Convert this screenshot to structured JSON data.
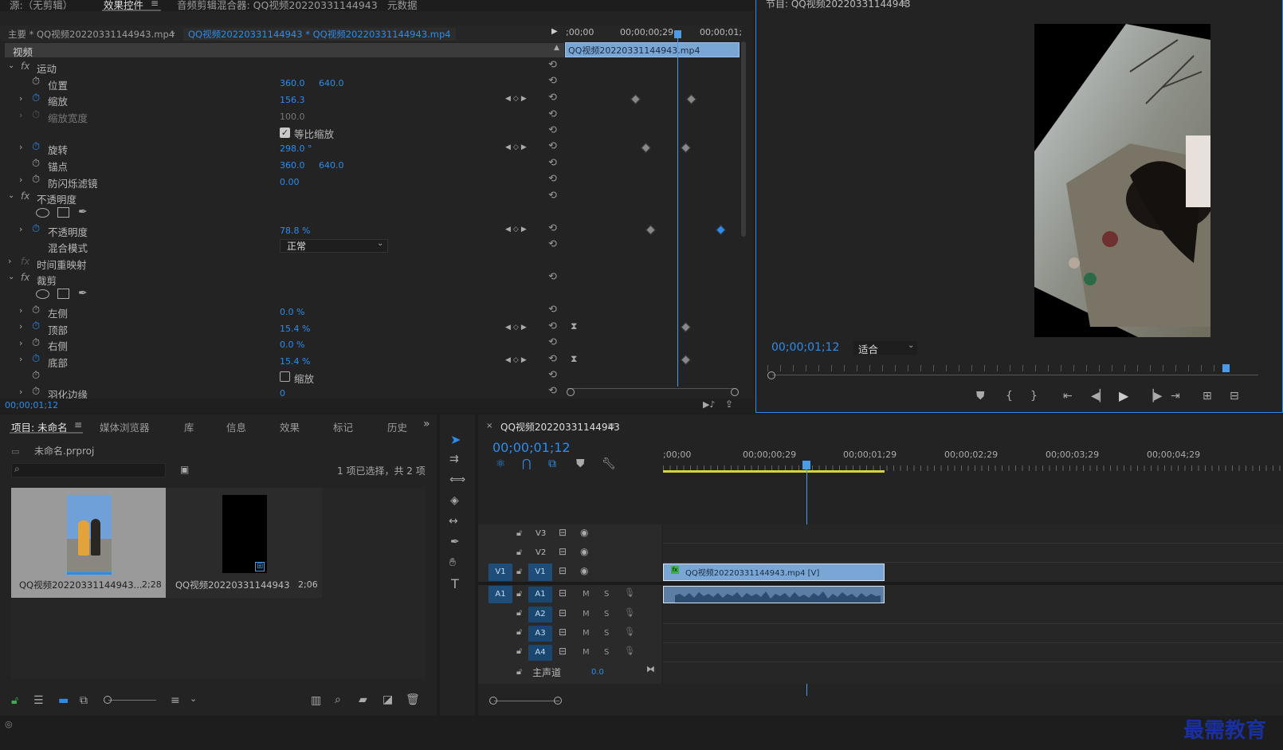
{
  "top_tabs": {
    "source": "源:（无剪辑）",
    "effect_controls": "效果控件",
    "audio_mixer": "音频剪辑混合器: QQ视频20220331144943",
    "metadata": "元数据"
  },
  "ec": {
    "master_label": "主要 * QQ视频20220331144943.mp4",
    "clip_label": "QQ视频20220331144943 * QQ视频20220331144943.mp4",
    "video_header": "视频",
    "tl_times": [
      ";00;00",
      "00;00;00;29",
      "00;00;01;"
    ],
    "clip_bar": "QQ视频20220331144943.mp4",
    "motion": "运动",
    "position": {
      "label": "位置",
      "x": "360.0",
      "y": "640.0"
    },
    "scale": {
      "label": "缩放",
      "value": "156.3"
    },
    "scale_width": {
      "label": "缩放宽度",
      "value": "100.0"
    },
    "uniform": "等比缩放",
    "rotation": {
      "label": "旋转",
      "value": "298.0 °"
    },
    "anchor": {
      "label": "锚点",
      "x": "360.0",
      "y": "640.0"
    },
    "flicker": {
      "label": "防闪烁滤镜",
      "value": "0.00"
    },
    "opacity_group": "不透明度",
    "opacity": {
      "label": "不透明度",
      "value": "78.8 %"
    },
    "blend": {
      "label": "混合模式",
      "value": "正常"
    },
    "time_remap": "时间重映射",
    "crop": "裁剪",
    "left": {
      "label": "左侧",
      "value": "0.0 %"
    },
    "top": {
      "label": "顶部",
      "value": "15.4 %"
    },
    "right": {
      "label": "右侧",
      "value": "0.0 %"
    },
    "bottom": {
      "label": "底部",
      "value": "15.4 %"
    },
    "zoom": "缩放",
    "feather": {
      "label": "羽化边缘",
      "value": "0"
    },
    "timecode": "00;00;01;12"
  },
  "program": {
    "title": "节目: QQ视频20220331144943",
    "timecode": "00;00;01;12",
    "fit": "适合"
  },
  "project": {
    "tabs": [
      "项目: 未命名",
      "媒体浏览器",
      "库",
      "信息",
      "效果",
      "标记",
      "历史"
    ],
    "file": "未命名.prproj",
    "selection": "1 项已选择，共 2 项",
    "items": [
      {
        "name": "QQ视频20220331144943...",
        "dur": "2;28"
      },
      {
        "name": "QQ视频20220331144943",
        "dur": "2;06"
      }
    ]
  },
  "timeline": {
    "title": "QQ视频20220331144943",
    "timecode": "00;00;01;12",
    "ruler": [
      ";00;00",
      "00;00;00;29",
      "00;00;01;29",
      "00;00;02;29",
      "00;00;03;29",
      "00;00;04;29"
    ],
    "tracks_v": [
      "V3",
      "V2",
      "V1"
    ],
    "tracks_a": [
      "A1",
      "A2",
      "A3",
      "A4"
    ],
    "src_v": "V1",
    "src_a": "A1",
    "master": "主声道",
    "master_val": "0.0",
    "clip_v": "QQ视频20220331144943.mp4 [V]",
    "m": "M",
    "s": "S"
  },
  "watermark": "最需教育"
}
